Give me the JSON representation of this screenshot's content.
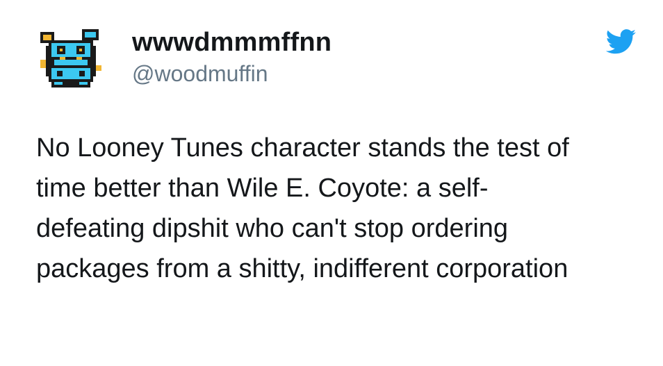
{
  "author": {
    "display_name": "wwwdmmmffnn",
    "handle": "@woodmuffin",
    "avatar_icon": "pixel-blob-avatar"
  },
  "brand": {
    "icon": "twitter-bird-icon",
    "color": "#1da1f2"
  },
  "tweet": {
    "text": "No Looney Tunes character stands the test of\ntime better than Wile E. Coyote: a self-\ndefeating dipshit who can't stop ordering\npackages from a shitty, indifferent corporation"
  },
  "colors": {
    "text": "#14171a",
    "handle": "#657786",
    "avatar_cyan": "#3cc8f0",
    "avatar_yellow": "#f2b632",
    "avatar_dark": "#1a1a1a"
  }
}
